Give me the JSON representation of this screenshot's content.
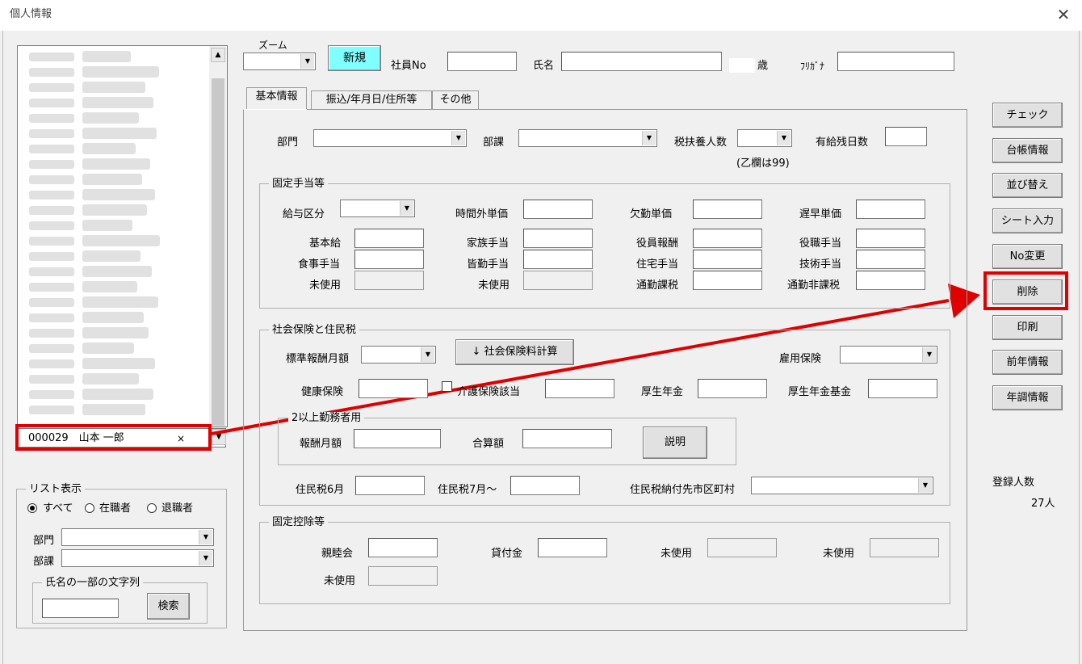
{
  "window": {
    "title": "個人情報"
  },
  "top": {
    "zoom_label": "ズーム",
    "zoom_value": "",
    "new_button": "新規",
    "empno_label": "社員No",
    "empno_value": "",
    "name_label": "氏名",
    "name_value": "",
    "age_unit": "歳",
    "furigana_label": "ﾌﾘｶﾞﾅ",
    "furigana_value": ""
  },
  "tabs": [
    {
      "label": "基本情報",
      "active": true
    },
    {
      "label": "振込/年月日/住所等",
      "active": false
    },
    {
      "label": "その他",
      "active": false
    }
  ],
  "basic": {
    "dept_label": "部門",
    "section_label": "部課",
    "dependents_label": "税扶養人数",
    "dependents_note": "(乙欄は99)",
    "paidleave_label": "有給残日数"
  },
  "fixed_allowance": {
    "title": "固定手当等",
    "pay_type_label": "給与区分",
    "overtime_label": "時間外単価",
    "absence_label": "欠勤単価",
    "late_label": "遅早単価",
    "fields": [
      [
        "基本給",
        "家族手当",
        "役員報酬",
        "役職手当"
      ],
      [
        "食事手当",
        "皆勤手当",
        "住宅手当",
        "技術手当"
      ],
      [
        "未使用",
        "未使用",
        "通勤課税",
        "通勤非課税"
      ]
    ]
  },
  "insurance": {
    "title": "社会保険と住民税",
    "std_monthly_label": "標準報酬月額",
    "calc_button": "↓ 社会保険料計算",
    "employment_label": "雇用保険",
    "health_label": "健康保険",
    "care_label": "介護保険該当",
    "pension_label": "厚生年金",
    "pension_fund_label": "厚生年金基金",
    "multi_title": "2以上勤務者用",
    "remun_label": "報酬月額",
    "total_label": "合算額",
    "explain_button": "説明",
    "resident_jun_label": "住民税6月",
    "resident_jul_label": "住民税7月～",
    "resident_city_label": "住民税納付先市区町村"
  },
  "deduction": {
    "title": "固定控除等",
    "social_label": "親睦会",
    "loan_label": "貸付金",
    "unused1_label": "未使用",
    "unused2_label": "未使用",
    "unused3_label": "未使用"
  },
  "right_buttons": [
    "チェック",
    "台帳情報",
    "並び替え",
    "シート入力",
    "No変更",
    "削除",
    "印刷",
    "前年情報",
    "年調情報"
  ],
  "registered": {
    "label": "登録人数",
    "count": "27人"
  },
  "employee_select": {
    "value": "000029　山本 一郎",
    "clear_glyph": "×"
  },
  "list_display": {
    "title": "リスト表示",
    "radio_all": "すべて",
    "radio_active": "在職者",
    "radio_retired": "退職者",
    "selected": "all",
    "dept_label": "部門",
    "section_label": "部課",
    "search_group": "氏名の一部の文字列",
    "search_value": "",
    "search_button": "検索"
  },
  "colors": {
    "highlight": "#e00000",
    "new_button_bg": "#7fffff"
  }
}
